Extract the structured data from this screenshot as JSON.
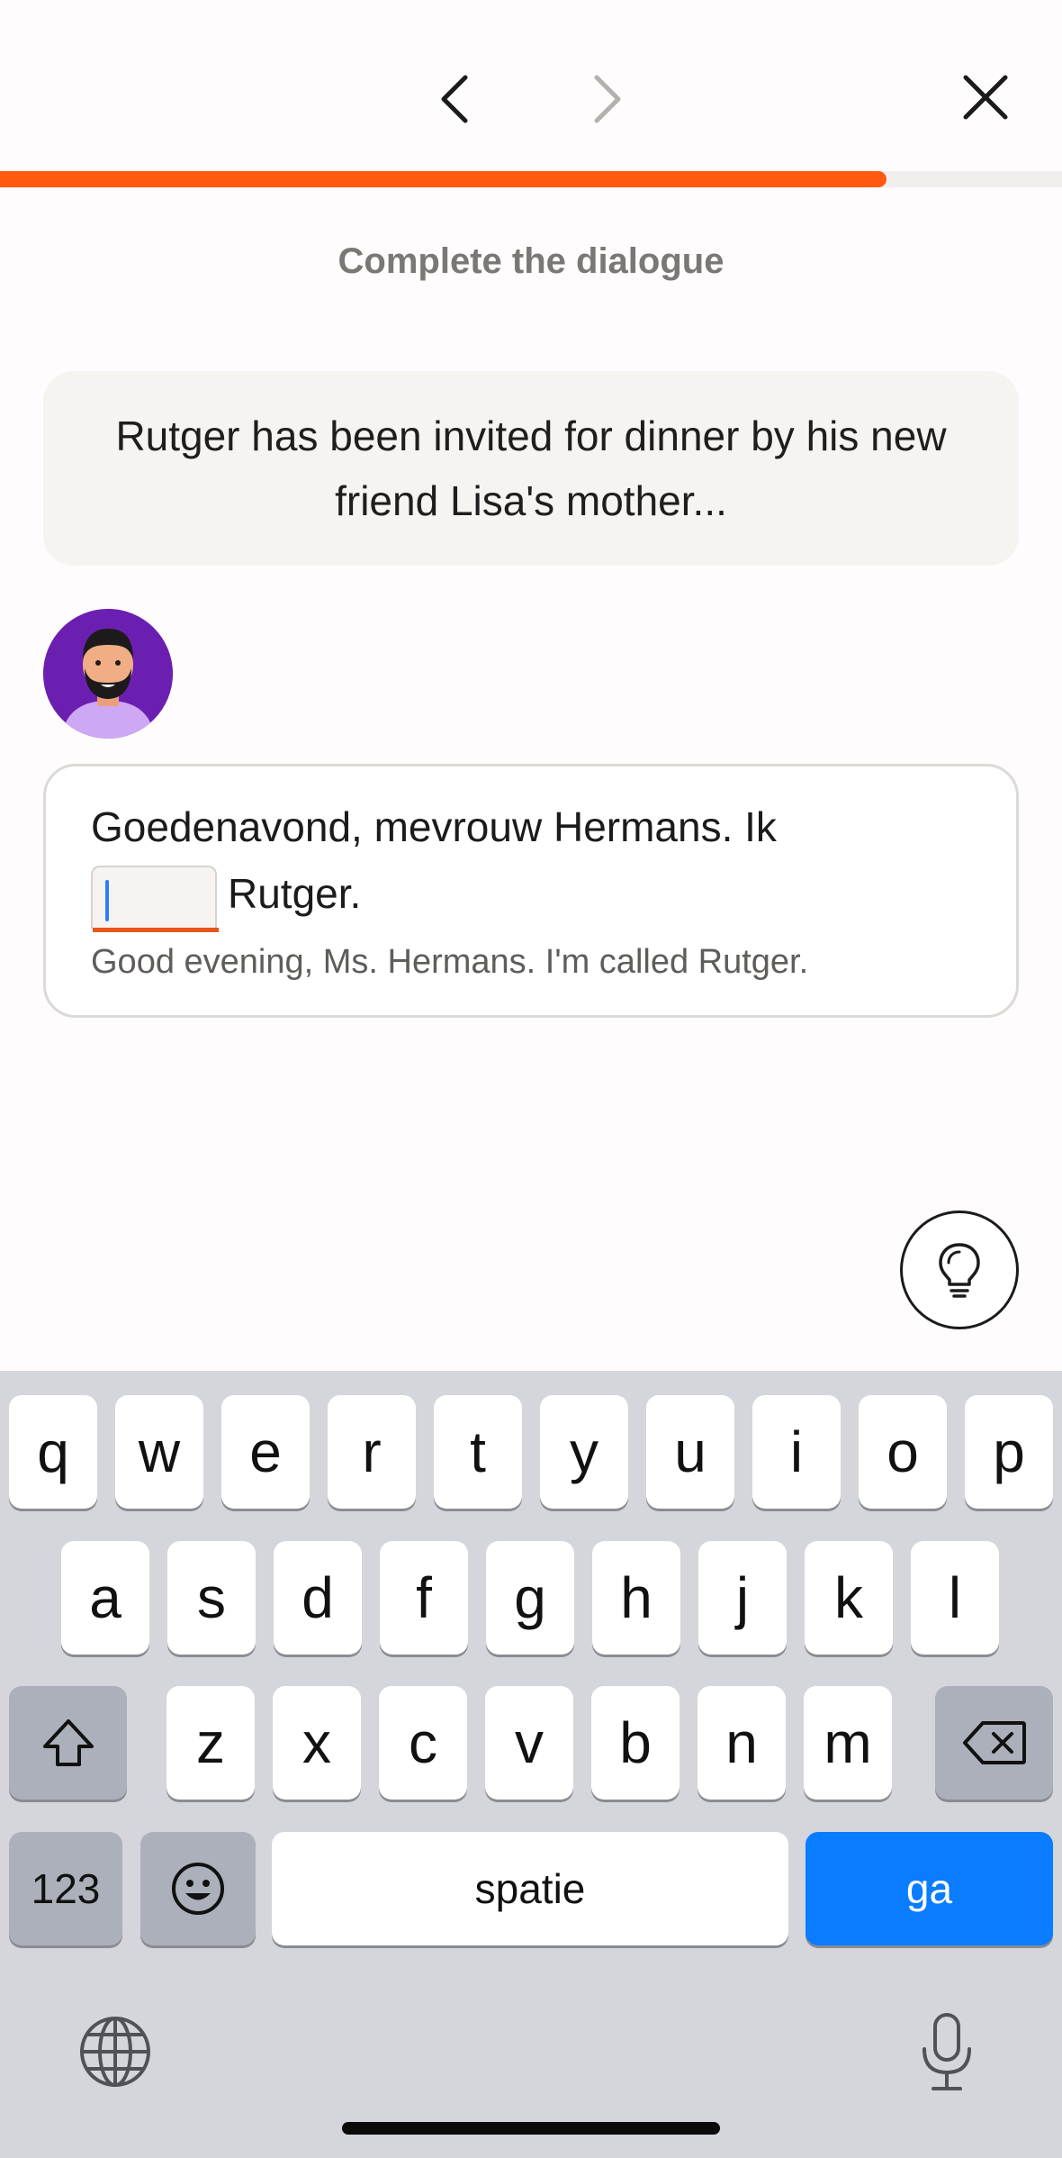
{
  "header": {
    "back_icon": "chevron-left-icon",
    "forward_icon": "chevron-right-icon",
    "close_icon": "close-icon",
    "progress": 0.835
  },
  "exercise": {
    "title": "Complete the dialogue",
    "context": "Rutger has been invited for dinner by his new friend Lisa's mother...",
    "speaker_avatar": "man-with-beard-avatar",
    "line_before_blank": "Goedenavond, mevrouw Hermans. Ik",
    "blank_value": "",
    "line_after_blank": "Rutger.",
    "translation": "Good evening, Ms. Hermans. I'm called Rutger.",
    "hint_icon": "lightbulb-icon"
  },
  "keyboard": {
    "row1": [
      "q",
      "w",
      "e",
      "r",
      "t",
      "y",
      "u",
      "i",
      "o",
      "p"
    ],
    "row2": [
      "a",
      "s",
      "d",
      "f",
      "g",
      "h",
      "j",
      "k",
      "l"
    ],
    "row3": [
      "z",
      "x",
      "c",
      "v",
      "b",
      "n",
      "m"
    ],
    "shift_icon": "shift-icon",
    "backspace_icon": "backspace-icon",
    "numbers_label": "123",
    "emoji_icon": "emoji-icon",
    "space_label": "spatie",
    "return_label": "ga",
    "globe_icon": "globe-icon",
    "mic_icon": "microphone-icon"
  },
  "colors": {
    "accent": "#ff5a0f",
    "return_key": "#0a7cff",
    "avatar_bg": "#6b1fb1"
  }
}
